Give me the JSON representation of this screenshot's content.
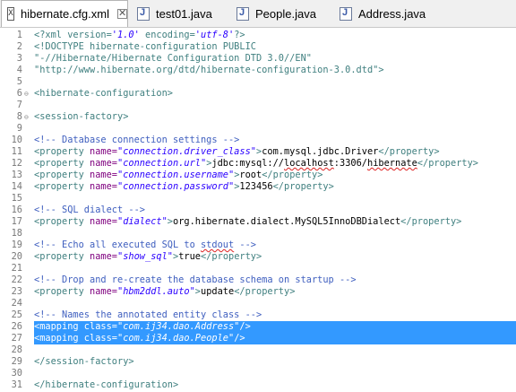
{
  "tabs": [
    {
      "label": "hibernate.cfg.xml",
      "icon": "xml-file-icon",
      "active": true,
      "close": "✕"
    },
    {
      "label": "test01.java",
      "icon": "java-file-icon",
      "active": false
    },
    {
      "label": "People.java",
      "icon": "java-file-icon",
      "active": false
    },
    {
      "label": "Address.java",
      "icon": "java-file-icon",
      "active": false
    }
  ],
  "editor": {
    "lines": [
      {
        "n": "1",
        "parts": [
          [
            "pi",
            "<?xml version="
          ],
          [
            "str",
            "'1.0'"
          ],
          [
            "pi",
            " encoding="
          ],
          [
            "str",
            "'utf-8'"
          ],
          [
            "pi",
            "?>"
          ]
        ]
      },
      {
        "n": "2",
        "parts": [
          [
            "dtd",
            "<!DOCTYPE hibernate-configuration PUBLIC"
          ]
        ]
      },
      {
        "n": "3",
        "parts": [
          [
            "dtd",
            "\"-//Hibernate/Hibernate Configuration DTD 3.0//EN\""
          ]
        ]
      },
      {
        "n": "4",
        "parts": [
          [
            "dtd",
            "\"http://www.hibernate.org/dtd/hibernate-configuration-3.0.dtd\">"
          ]
        ]
      },
      {
        "n": "5",
        "parts": []
      },
      {
        "n": "6",
        "fold": "⊖",
        "parts": [
          [
            "tag",
            "<hibernate-configuration>"
          ]
        ]
      },
      {
        "n": "7",
        "parts": []
      },
      {
        "n": "8",
        "fold": "⊖",
        "parts": [
          [
            "tag",
            "<session-factory>"
          ]
        ]
      },
      {
        "n": "9",
        "parts": []
      },
      {
        "n": "10",
        "parts": [
          [
            "comment",
            "<!-- Database connection settings -->"
          ]
        ]
      },
      {
        "n": "11",
        "parts": [
          [
            "tag",
            "<property "
          ],
          [
            "attr",
            "name="
          ],
          [
            "val",
            "\"connection.driver_class\""
          ],
          [
            "tag",
            ">"
          ],
          [
            "text",
            "com.mysql.jdbc.Driver"
          ],
          [
            "tag",
            "</property>"
          ]
        ]
      },
      {
        "n": "12",
        "parts": [
          [
            "tag",
            "<property "
          ],
          [
            "attr",
            "name="
          ],
          [
            "val",
            "\"connection.url\""
          ],
          [
            "tag",
            ">"
          ],
          [
            "text",
            "jdbc:mysql://"
          ],
          [
            "textsq",
            "localhost"
          ],
          [
            "text",
            ":3306/"
          ],
          [
            "textsq",
            "hibernate"
          ],
          [
            "tag",
            "</property>"
          ]
        ]
      },
      {
        "n": "13",
        "parts": [
          [
            "tag",
            "<property "
          ],
          [
            "attr",
            "name="
          ],
          [
            "val",
            "\"connection.username\""
          ],
          [
            "tag",
            ">"
          ],
          [
            "text",
            "root"
          ],
          [
            "tag",
            "</property>"
          ]
        ]
      },
      {
        "n": "14",
        "parts": [
          [
            "tag",
            "<property "
          ],
          [
            "attr",
            "name="
          ],
          [
            "val",
            "\"connection.password\""
          ],
          [
            "tag",
            ">"
          ],
          [
            "text",
            "123456"
          ],
          [
            "tag",
            "</property>"
          ]
        ]
      },
      {
        "n": "15",
        "parts": []
      },
      {
        "n": "16",
        "parts": [
          [
            "comment",
            "<!-- SQL dialect -->"
          ]
        ]
      },
      {
        "n": "17",
        "parts": [
          [
            "tag",
            "<property "
          ],
          [
            "attr",
            "name="
          ],
          [
            "val",
            "\"dialect\""
          ],
          [
            "tag",
            ">"
          ],
          [
            "text",
            "org.hibernate.dialect.MySQL5InnoDBDialect"
          ],
          [
            "tag",
            "</property>"
          ]
        ]
      },
      {
        "n": "18",
        "parts": []
      },
      {
        "n": "19",
        "parts": [
          [
            "comment",
            "<!-- Echo all executed SQL to "
          ],
          [
            "commentsq",
            "stdout"
          ],
          [
            "comment",
            " -->"
          ]
        ]
      },
      {
        "n": "20",
        "parts": [
          [
            "tag",
            "<property "
          ],
          [
            "attr",
            "name="
          ],
          [
            "val",
            "\"show_sql\""
          ],
          [
            "tag",
            ">"
          ],
          [
            "text",
            "true"
          ],
          [
            "tag",
            "</property>"
          ]
        ]
      },
      {
        "n": "21",
        "parts": []
      },
      {
        "n": "22",
        "parts": [
          [
            "comment",
            "<!-- Drop and re-create the database schema on startup -->"
          ]
        ]
      },
      {
        "n": "23",
        "parts": [
          [
            "tag",
            "<property "
          ],
          [
            "attr",
            "name="
          ],
          [
            "val",
            "\"hbm2ddl.auto\""
          ],
          [
            "tag",
            ">"
          ],
          [
            "text",
            "update"
          ],
          [
            "tag",
            "</property>"
          ]
        ]
      },
      {
        "n": "24",
        "parts": []
      },
      {
        "n": "25",
        "parts": [
          [
            "comment",
            "<!-- Names the annotated entity class -->"
          ]
        ]
      },
      {
        "n": "26",
        "sel": true,
        "parts": [
          [
            "tag",
            "<mapping "
          ],
          [
            "attr",
            "class="
          ],
          [
            "val",
            "\"com.ij34.dao.Address\""
          ],
          [
            "tag",
            "/>"
          ]
        ]
      },
      {
        "n": "27",
        "sel": true,
        "parts": [
          [
            "tag",
            "<mapping "
          ],
          [
            "attr",
            "class="
          ],
          [
            "val",
            "\"com.ij34.dao.People\""
          ],
          [
            "tag",
            "/>"
          ]
        ]
      },
      {
        "n": "28",
        "parts": []
      },
      {
        "n": "29",
        "parts": [
          [
            "tag",
            "</session-factory>"
          ]
        ]
      },
      {
        "n": "30",
        "parts": []
      },
      {
        "n": "31",
        "parts": [
          [
            "tag",
            "</hibernate-configuration>"
          ]
        ]
      }
    ]
  },
  "colors": {
    "selection": "#3399ff",
    "tag": "#3f7f7f",
    "attribute": "#7f007f",
    "value": "#2a00ff",
    "comment": "#3f5fbf"
  }
}
